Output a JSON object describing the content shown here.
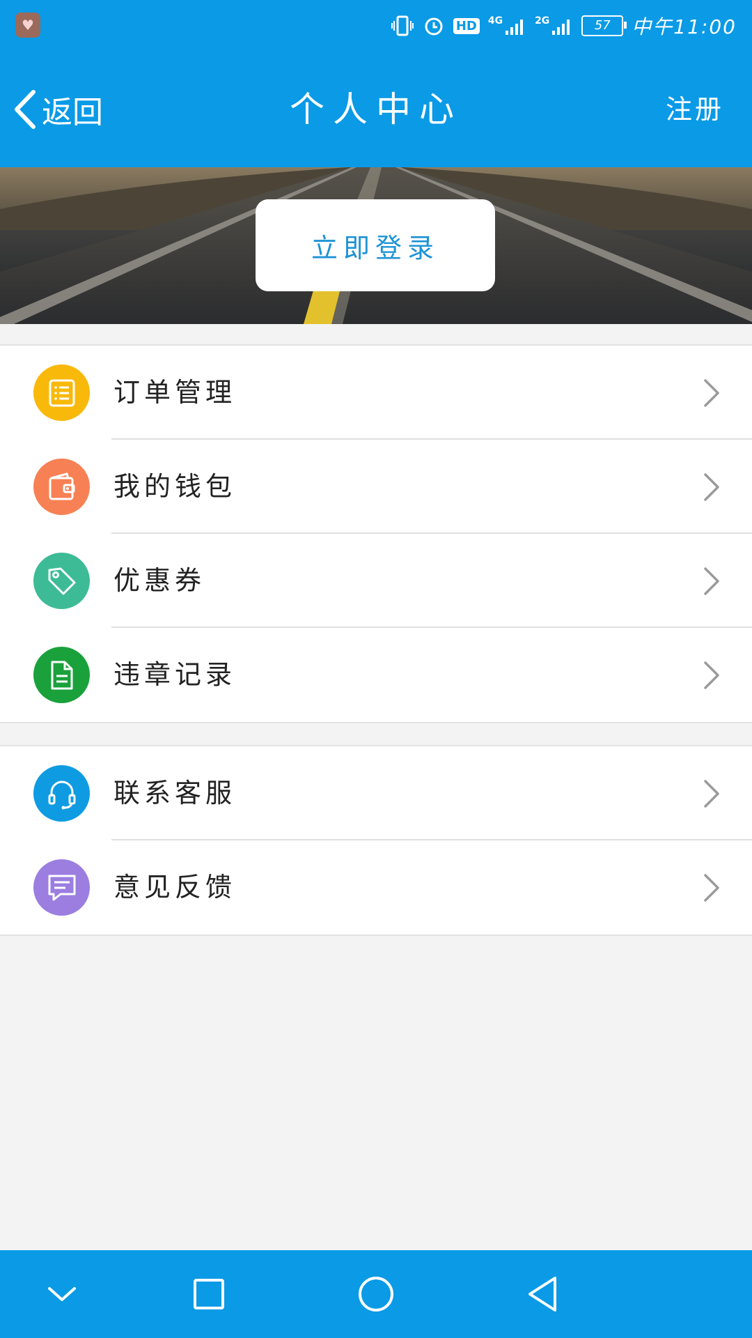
{
  "status_bar": {
    "network_4g": "4G",
    "network_2g": "2G",
    "hd": "HD",
    "battery": "57",
    "time": "中午11:00"
  },
  "nav": {
    "back_label": "返回",
    "title": "个人中心",
    "register_label": "注册"
  },
  "banner": {
    "login_label": "立即登录"
  },
  "menu_group1": [
    {
      "label": "订单管理",
      "icon": "order-list-icon",
      "color": "#f9b90b"
    },
    {
      "label": "我的钱包",
      "icon": "wallet-icon",
      "color": "#f78154"
    },
    {
      "label": "优惠券",
      "icon": "coupon-tag-icon",
      "color": "#3dbb97"
    },
    {
      "label": "违章记录",
      "icon": "document-icon",
      "color": "#1aa13c"
    }
  ],
  "menu_group2": [
    {
      "label": "联系客服",
      "icon": "headset-icon",
      "color": "#0f9be2"
    },
    {
      "label": "意见反馈",
      "icon": "chat-bubble-icon",
      "color": "#9b7ee0"
    }
  ],
  "colors": {
    "primary": "#0a9ae6",
    "page_background": "#f3f3f3",
    "login_text": "#1d93d5"
  }
}
